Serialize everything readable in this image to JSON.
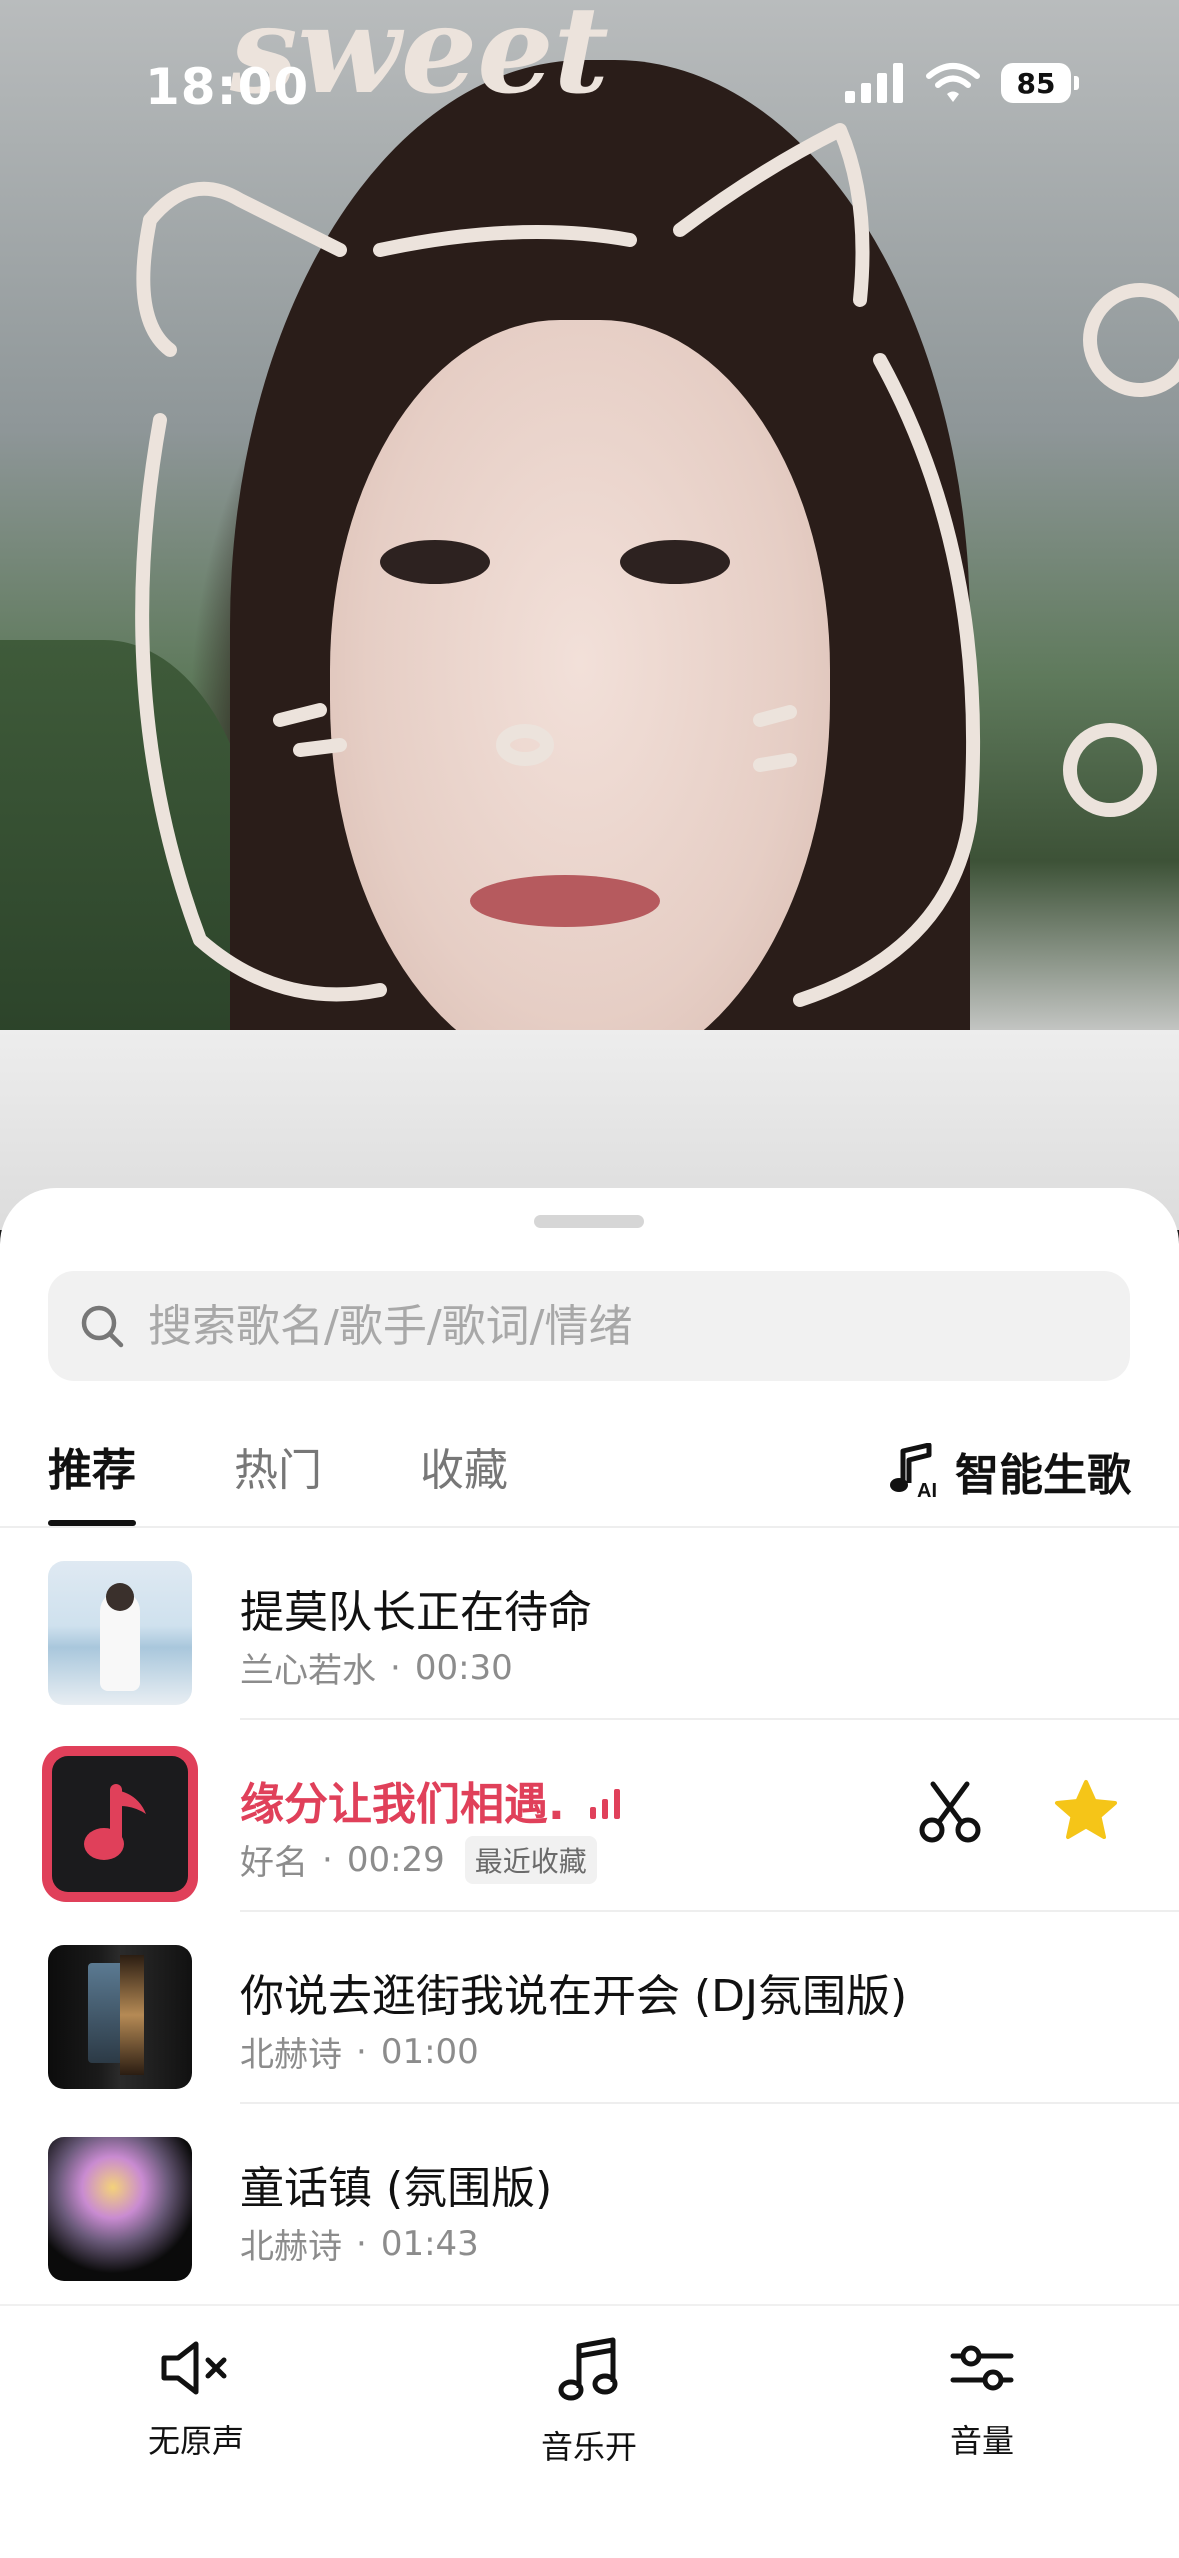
{
  "status_bar": {
    "time": "18:00",
    "battery": "85"
  },
  "preview": {
    "sticker_text": "sweet"
  },
  "search": {
    "placeholder": "搜索歌名/歌手/歌词/情绪"
  },
  "tabs": [
    {
      "label": "推荐",
      "active": true
    },
    {
      "label": "热门",
      "active": false
    },
    {
      "label": "收藏",
      "active": false
    }
  ],
  "smart_song": {
    "label": "智能生歌",
    "icon": "music-ai-icon"
  },
  "songs": [
    {
      "title": "提莫队长正在待命",
      "artist": "兰心若水",
      "duration": "00:30"
    },
    {
      "title": "缘分让我们相遇.",
      "artist": "好名",
      "duration": "00:29",
      "badge": "最近收藏",
      "playing": true
    },
    {
      "title": "你说去逛街我说在开会 (DJ氛围版)",
      "artist": "北赫诗",
      "duration": "01:00"
    },
    {
      "title": "童话镇 (氛围版)",
      "artist": "北赫诗",
      "duration": "01:43"
    }
  ],
  "meta_separator": "·",
  "toolbar": {
    "mute_label": "无原声",
    "music_label": "音乐开",
    "volume_label": "音量"
  },
  "colors": {
    "accent": "#e0405a",
    "star": "#f5c518"
  }
}
